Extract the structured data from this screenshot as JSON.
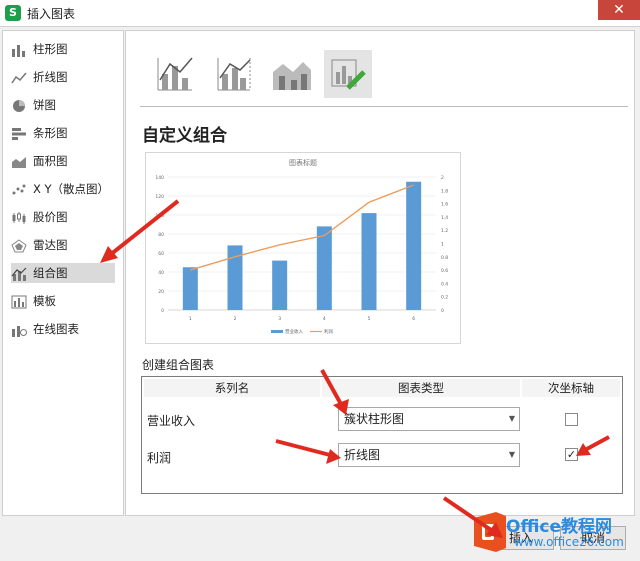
{
  "window": {
    "title": "插入图表",
    "close_glyph": "✕"
  },
  "sidebar": {
    "items": [
      {
        "label": "柱形图",
        "icon": "column-chart-icon"
      },
      {
        "label": "折线图",
        "icon": "line-chart-icon"
      },
      {
        "label": "饼图",
        "icon": "pie-chart-icon"
      },
      {
        "label": "条形图",
        "icon": "bar-chart-icon"
      },
      {
        "label": "面积图",
        "icon": "area-chart-icon"
      },
      {
        "label": "X Y（散点图）",
        "icon": "scatter-chart-icon"
      },
      {
        "label": "股价图",
        "icon": "stock-chart-icon"
      },
      {
        "label": "雷达图",
        "icon": "radar-chart-icon"
      },
      {
        "label": "组合图",
        "icon": "combo-chart-icon",
        "selected": true
      },
      {
        "label": "模板",
        "icon": "template-icon"
      },
      {
        "label": "在线图表",
        "icon": "online-chart-icon"
      }
    ]
  },
  "main": {
    "section_title": "自定义组合",
    "sub_title": "创建组合图表",
    "table": {
      "headers": [
        "系列名",
        "图表类型",
        "次坐标轴"
      ],
      "rows": [
        {
          "name": "营业收入",
          "type": "簇状柱形图",
          "secondary": false
        },
        {
          "name": "利润",
          "type": "折线图",
          "secondary": true
        }
      ]
    }
  },
  "footer": {
    "insert_label": "插入",
    "cancel_label": "取消"
  },
  "watermark": {
    "brand": "Office教程网",
    "url": "www.office26.com"
  },
  "colors": {
    "bar": "#5b9bd5",
    "line": "#ed9c5c",
    "close": "#c7453a",
    "arrow": "#e02a20"
  },
  "chart_data": {
    "type": "bar",
    "title": "图表标题",
    "categories": [
      "1",
      "2",
      "3",
      "4",
      "5",
      "6"
    ],
    "series": [
      {
        "name": "营业收入",
        "type": "bar",
        "axis": "primary",
        "values": [
          45,
          68,
          52,
          88,
          102,
          135
        ]
      },
      {
        "name": "利润",
        "type": "line",
        "axis": "secondary",
        "values": [
          0.6,
          0.8,
          0.98,
          1.12,
          1.62,
          1.88
        ]
      }
    ],
    "y_ticks": [
      "0",
      "20",
      "40",
      "60",
      "80",
      "100",
      "120",
      "140"
    ],
    "y2_ticks": [
      "0",
      "0.2",
      "0.4",
      "0.6",
      "0.8",
      "1",
      "1.2",
      "1.4",
      "1.6",
      "1.8",
      "2"
    ],
    "ylim": [
      0,
      140
    ],
    "y2lim": [
      0,
      2
    ],
    "grid": true,
    "legend": "bottom"
  }
}
